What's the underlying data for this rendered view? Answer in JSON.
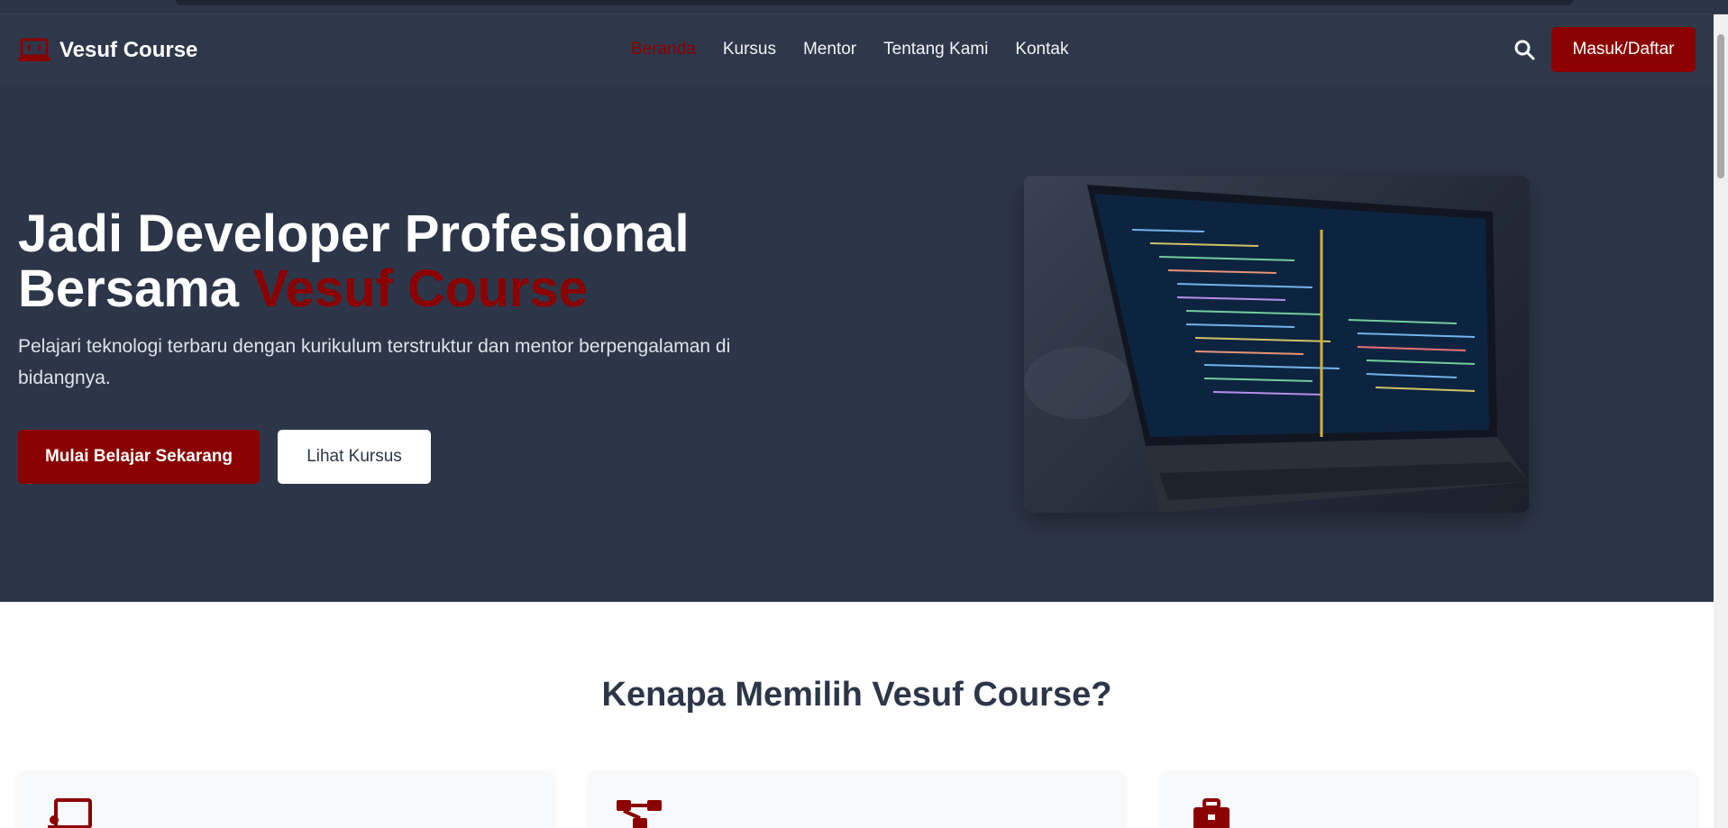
{
  "brand": {
    "name": "Vesuf Course",
    "accent": "#8b0000"
  },
  "nav": {
    "links": [
      {
        "label": "Beranda",
        "active": true
      },
      {
        "label": "Kursus",
        "active": false
      },
      {
        "label": "Mentor",
        "active": false
      },
      {
        "label": "Tentang Kami",
        "active": false
      },
      {
        "label": "Kontak",
        "active": false
      }
    ],
    "login_label": "Masuk/Daftar"
  },
  "hero": {
    "title_line1": "Jadi Developer Profesional",
    "title_line2_prefix": "Bersama ",
    "title_line2_accent": "Vesuf Course",
    "subtitle": "Pelajari teknologi terbaru dengan kurikulum terstruktur dan mentor berpengalaman di bidangnya.",
    "primary_cta": "Mulai Belajar Sekarang",
    "secondary_cta": "Lihat Kursus"
  },
  "why": {
    "title": "Kenapa Memilih Vesuf Course?",
    "cards": [
      {
        "icon": "presentation-icon"
      },
      {
        "icon": "sitemap-icon"
      },
      {
        "icon": "briefcase-icon"
      }
    ]
  }
}
